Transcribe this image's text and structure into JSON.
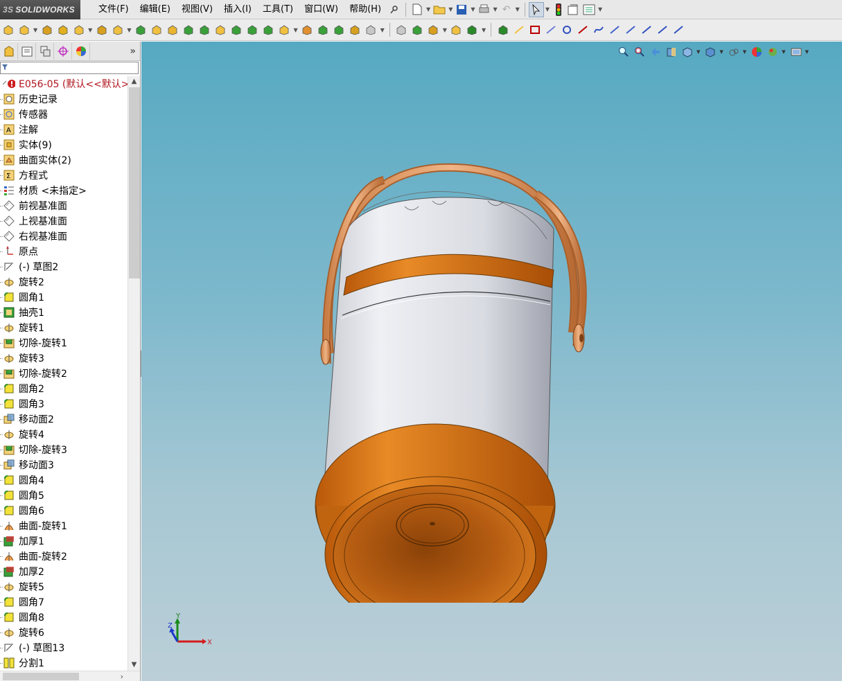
{
  "app": {
    "logo_prefix": "3S",
    "logo_text": "SOLIDWORKS"
  },
  "menu": [
    "文件(F)",
    "编辑(E)",
    "视图(V)",
    "插入(I)",
    "工具(T)",
    "窗口(W)",
    "帮助(H)"
  ],
  "panel": {
    "more_label": "»",
    "filter_placeholder": "",
    "root_label": "E056-05  (默认<<默认>",
    "tree": [
      {
        "label": "历史记录",
        "icon": "history-icon"
      },
      {
        "label": "传感器",
        "icon": "sensor-icon"
      },
      {
        "label": "注解",
        "icon": "annotation-icon"
      },
      {
        "label": "实体(9)",
        "icon": "solid-bodies-icon"
      },
      {
        "label": "曲面实体(2)",
        "icon": "surface-bodies-icon"
      },
      {
        "label": "方程式",
        "icon": "equations-icon"
      },
      {
        "label": "材质 <未指定>",
        "icon": "material-icon"
      },
      {
        "label": "前视基准面",
        "icon": "plane-icon"
      },
      {
        "label": "上视基准面",
        "icon": "plane-icon"
      },
      {
        "label": "右视基准面",
        "icon": "plane-icon"
      },
      {
        "label": "原点",
        "icon": "origin-icon"
      },
      {
        "label": "(-) 草图2",
        "icon": "sketch-icon"
      },
      {
        "label": "旋转2",
        "icon": "revolve-icon"
      },
      {
        "label": "圆角1",
        "icon": "fillet-icon"
      },
      {
        "label": "抽壳1",
        "icon": "shell-icon"
      },
      {
        "label": "旋转1",
        "icon": "revolve-icon"
      },
      {
        "label": "切除-旋转1",
        "icon": "revolve-cut-icon"
      },
      {
        "label": "旋转3",
        "icon": "revolve-icon"
      },
      {
        "label": "切除-旋转2",
        "icon": "revolve-cut-icon"
      },
      {
        "label": "圆角2",
        "icon": "fillet-icon"
      },
      {
        "label": "圆角3",
        "icon": "fillet-icon"
      },
      {
        "label": "移动面2",
        "icon": "move-face-icon"
      },
      {
        "label": "旋转4",
        "icon": "revolve-icon"
      },
      {
        "label": "切除-旋转3",
        "icon": "revolve-cut-icon"
      },
      {
        "label": "移动面3",
        "icon": "move-face-icon"
      },
      {
        "label": "圆角4",
        "icon": "fillet-icon"
      },
      {
        "label": "圆角5",
        "icon": "fillet-icon"
      },
      {
        "label": "圆角6",
        "icon": "fillet-icon"
      },
      {
        "label": "曲面-旋转1",
        "icon": "surface-revolve-icon"
      },
      {
        "label": "加厚1",
        "icon": "thicken-icon"
      },
      {
        "label": "曲面-旋转2",
        "icon": "surface-revolve-icon"
      },
      {
        "label": "加厚2",
        "icon": "thicken-icon"
      },
      {
        "label": "旋转5",
        "icon": "revolve-icon"
      },
      {
        "label": "圆角7",
        "icon": "fillet-icon"
      },
      {
        "label": "圆角8",
        "icon": "fillet-icon"
      },
      {
        "label": "旋转6",
        "icon": "revolve-icon"
      },
      {
        "label": "(-) 草图13",
        "icon": "sketch-icon"
      },
      {
        "label": "分割1",
        "icon": "split-icon"
      }
    ]
  },
  "triad": {
    "x_label": "X",
    "y_label": "Y",
    "z_label": "Z"
  },
  "colors": {
    "accent_orange": "#d9720f",
    "body_white": "#e6e8ee",
    "background_top": "#56a9c2",
    "background_bottom": "#bccfd8"
  }
}
